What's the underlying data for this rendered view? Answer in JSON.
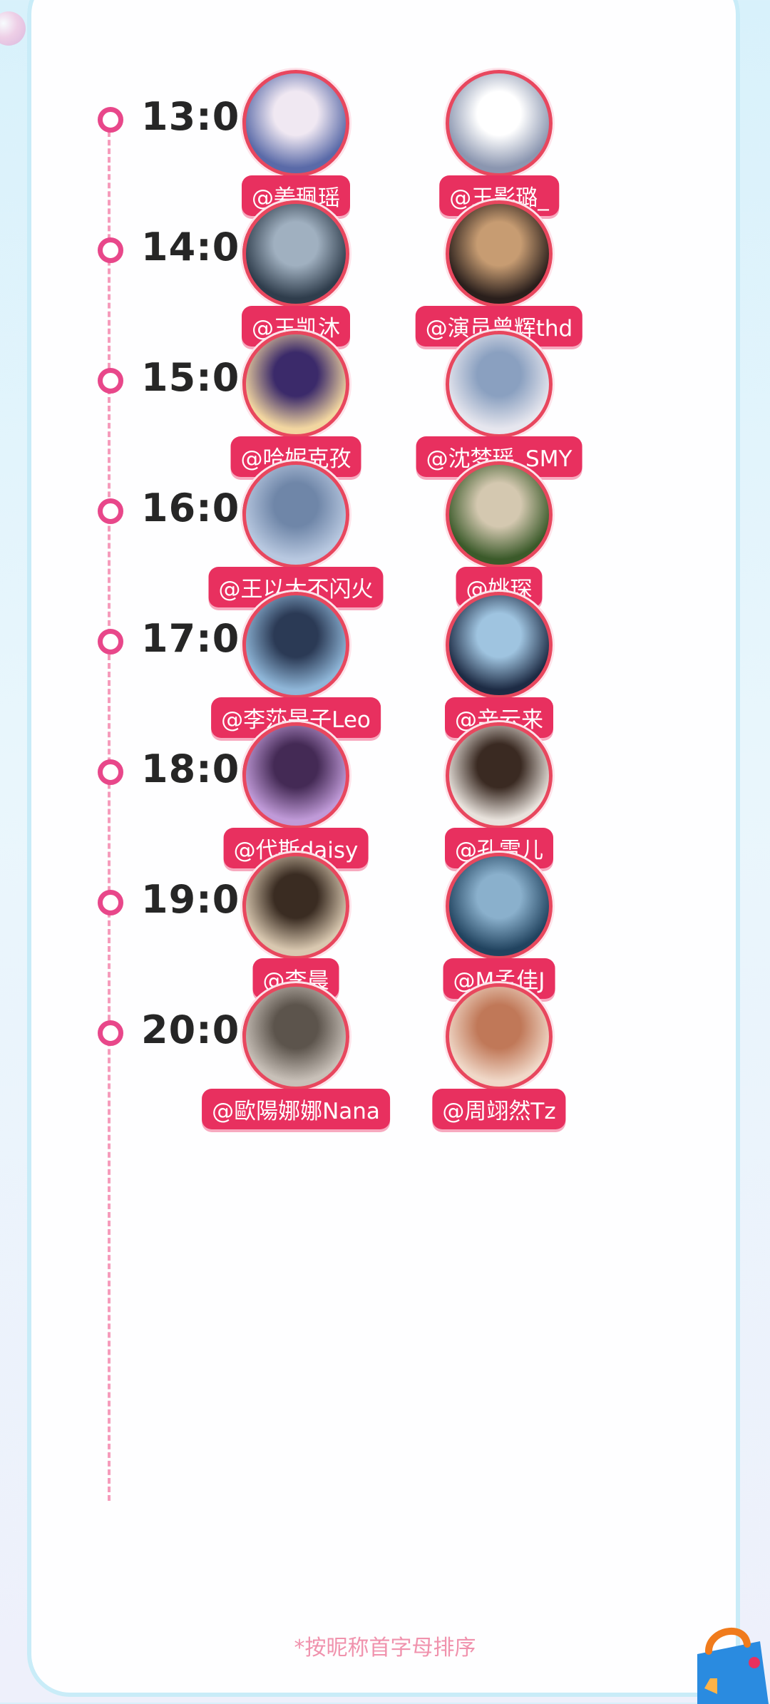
{
  "slots": [
    {
      "time": "13:00",
      "people": [
        {
          "handle": "@姜珮瑶",
          "icon": "child-avatar"
        },
        {
          "handle": "@王影璐_",
          "icon": "cartoon-avatar"
        }
      ]
    },
    {
      "time": "14:00",
      "people": [
        {
          "handle": "@王凯沐",
          "icon": "man-back-avatar"
        },
        {
          "handle": "@演员曾辉thd",
          "icon": "stage-avatar"
        }
      ]
    },
    {
      "time": "15:00",
      "people": [
        {
          "handle": "@哈妮克孜",
          "icon": "anime-avatar"
        },
        {
          "handle": "@沈梦瑶_SMY",
          "icon": "girl-cat-avatar"
        }
      ]
    },
    {
      "time": "16:00",
      "people": [
        {
          "handle": "@王以太不闪火",
          "icon": "statue-avatar"
        },
        {
          "handle": "@姚琛",
          "icon": "outdoor-avatar"
        }
      ]
    },
    {
      "time": "17:00",
      "people": [
        {
          "handle": "@李莎旻子Leo",
          "icon": "woman-blue-avatar"
        },
        {
          "handle": "@辛云来",
          "icon": "man-blue-avatar"
        }
      ]
    },
    {
      "time": "18:00",
      "people": [
        {
          "handle": "@代斯daisy",
          "icon": "woman-purple-avatar"
        },
        {
          "handle": "@孔雪儿",
          "icon": "woman-white-avatar"
        }
      ]
    },
    {
      "time": "19:00",
      "people": [
        {
          "handle": "@李晨",
          "icon": "forest-avatar"
        },
        {
          "handle": "@M孟佳J",
          "icon": "ocean-avatar"
        }
      ]
    },
    {
      "time": "20:00",
      "people": [
        {
          "handle": "@歐陽娜娜Nana",
          "icon": "flower-avatar"
        },
        {
          "handle": "@周翊然Tz",
          "icon": "boy-avatar"
        }
      ]
    }
  ],
  "footnote": "*按昵称首字母排序",
  "colors": {
    "accent": "#e8305f",
    "dot": "#e8478a",
    "line": "#f59bbb",
    "text": "#262626"
  }
}
